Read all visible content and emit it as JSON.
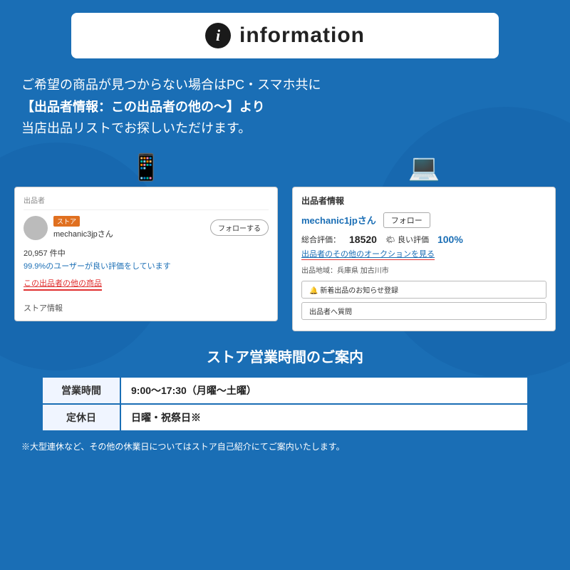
{
  "background_color": "#1a6eb5",
  "header": {
    "icon_label": "i",
    "title": "information"
  },
  "main_text": {
    "line1": "ご希望の商品が見つからない場合はPC・スマホ共に",
    "line2": "【出品者情報：この出品者の他の〜】より",
    "line3": "当店出品リストでお探しいただけます。"
  },
  "mobile_screenshot": {
    "device_icon": "📱",
    "section_label": "出品者",
    "store_badge": "ストア",
    "seller_name": "mechanic3jpさん",
    "follow_button": "フォローする",
    "review_count": "20,957 件中",
    "review_pct": "99.9%のユーザーが良い評価をしています",
    "other_items_link": "この出品者の他の商品",
    "store_info": "ストア情報"
  },
  "pc_screenshot": {
    "device_icon": "💻",
    "section_title": "出品者情報",
    "seller_name": "mechanic1jpさん",
    "follow_button": "フォロー",
    "rating_label": "総合評価：",
    "rating_num": "18520",
    "good_label": "🌤 良い評価",
    "good_pct": "100%",
    "auction_link": "出品者のその他のオークションを見る",
    "location_label": "出品地域：兵庫県 加古川市",
    "notify_btn": "🔔 新着出品のお知らせ登録",
    "question_btn": "出品者へ質問"
  },
  "business": {
    "title": "ストア営業時間のご案内",
    "row1_label": "営業時間",
    "row1_value": "9:00〜17:30（月曜〜土曜）",
    "row2_label": "定休日",
    "row2_value": "日曜・祝祭日※",
    "footnote": "※大型連休など、その他の休業日についてはストア自己紹介にてご案内いたします。"
  }
}
